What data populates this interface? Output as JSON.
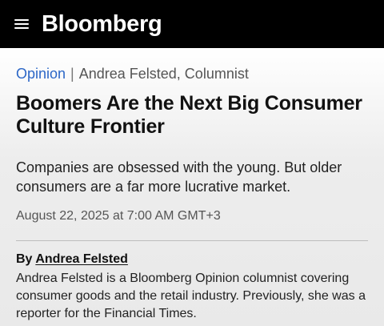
{
  "header": {
    "brand": "Bloomberg",
    "menu_icon": "hamburger-menu-icon"
  },
  "article": {
    "section": "Opinion",
    "separator": "|",
    "author_label": "Andrea Felsted, Columnist",
    "headline": "Boomers Are the Next Big Consumer Culture Frontier",
    "dek": "Companies are obsessed with the young. But older consumers are a far more lucrative market.",
    "date": "August 22, 2025 at 7:00 AM GMT+3",
    "byline_prefix": "By",
    "byline_author": "Andrea Felsted",
    "bio": "Andrea Felsted is a Bloomberg Opinion columnist covering consumer goods and the retail industry. Previously, she was a reporter for the Financial Times."
  },
  "colors": {
    "topbar": "#000000",
    "link": "#2c67c7"
  }
}
